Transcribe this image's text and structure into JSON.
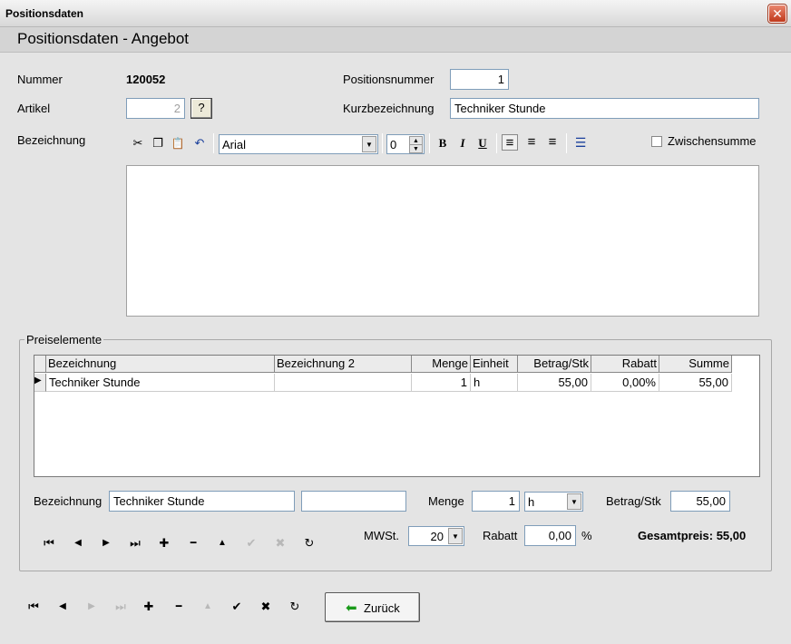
{
  "window": {
    "title": "Positionsdaten",
    "close_glyph": "✕"
  },
  "header": {
    "title": "Positionsdaten - Angebot"
  },
  "form": {
    "nummer_label": "Nummer",
    "nummer_value": "120052",
    "positionsnummer_label": "Positionsnummer",
    "positionsnummer_value": "1",
    "artikel_label": "Artikel",
    "artikel_value": "2",
    "artikel_lookup_label": "?",
    "kurzbezeichnung_label": "Kurzbezeichnung",
    "kurzbezeichnung_value": "Techniker Stunde",
    "bezeichnung_label": "Bezeichnung",
    "zwischensumme_label": "Zwischensumme",
    "zwischensumme_checked": false
  },
  "toolbar": {
    "font_name": "Arial",
    "font_size": "0",
    "icons": [
      "cut-icon",
      "copy-icon",
      "paste-icon",
      "undo-icon",
      "bold-icon",
      "italic-icon",
      "underline-icon",
      "align-left-icon",
      "align-center-icon",
      "align-right-icon",
      "bullet-list-icon"
    ],
    "glyphs": {
      "cut": "✂",
      "copy": "❐",
      "paste": "📋",
      "undo": "↶",
      "bold": "B",
      "italic": "I",
      "underline": "U",
      "align_left": "≡",
      "align_center": "≡",
      "align_right": "≡",
      "bullets": "☰"
    }
  },
  "preiselemente": {
    "title": "Preiselemente",
    "columns": [
      "Bezeichnung",
      "Bezeichnung 2",
      "Menge",
      "Einheit",
      "Betrag/Stk",
      "Rabatt",
      "Summe"
    ],
    "rows": [
      {
        "bezeichnung": "Techniker Stunde",
        "bezeichnung2": "",
        "menge": "1",
        "einheit": "h",
        "betrag": "55,00",
        "rabatt": "0,00%",
        "summe": "55,00"
      }
    ],
    "row_pointer": "▶",
    "detail": {
      "bezeichnung_label": "Bezeichnung",
      "bezeichnung_value": "Techniker Stunde",
      "bezeichnung2_value": "",
      "menge_label": "Menge",
      "menge_value": "1",
      "einheit_value": "h",
      "betrag_label": "Betrag/Stk",
      "betrag_value": "55,00",
      "mwst_label": "MWSt.",
      "mwst_value": "20",
      "rabatt_label": "Rabatt",
      "rabatt_value": "0,00",
      "rabatt_unit": "%",
      "gesamtpreis": "Gesamtpreis: 55,00"
    }
  },
  "nav": {
    "glyphs": {
      "first": "⏮",
      "prev": "◀",
      "next": "▶",
      "last": "⏭",
      "add": "✚",
      "remove": "━",
      "edit": "▲",
      "post": "✔",
      "cancel": "✖",
      "refresh": "↻"
    }
  },
  "footer": {
    "zurueck_label": "Zurück",
    "zurueck_icon_glyph": "⬅"
  }
}
